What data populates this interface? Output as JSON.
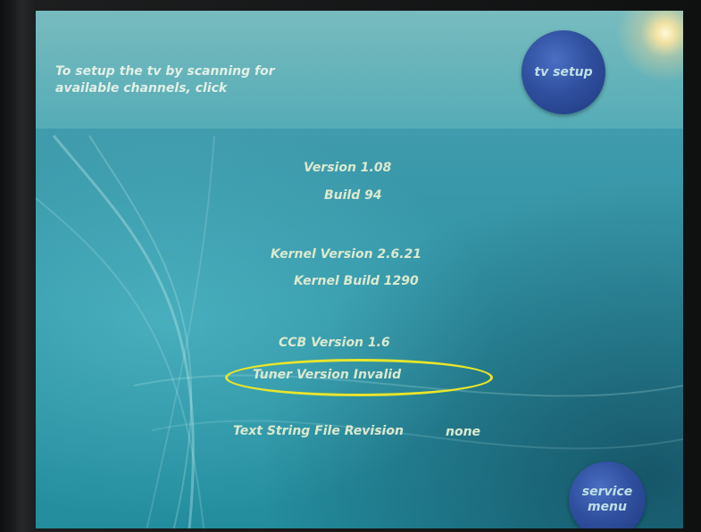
{
  "header": {
    "setup_prompt_line1": "To setup the tv by scanning for",
    "setup_prompt_line2": "available channels, click",
    "tv_setup_button": "tv setup"
  },
  "info": {
    "version": "Version 1.08",
    "build": "Build 94",
    "kernel_version": "Kernel Version 2.6.21",
    "kernel_build": "Kernel Build 1290",
    "ccb_version": "CCB Version 1.6",
    "tuner_version": "Tuner Version Invalid",
    "text_string_label": "Text String File Revision",
    "text_string_value": "none"
  },
  "footer": {
    "service_menu_line1": "service",
    "service_menu_line2": "menu"
  },
  "colors": {
    "screen_teal": "#3b99aa",
    "button_blue": "#30509f",
    "text_light": "#dbe9cf",
    "highlight_yellow": "#e8e52b"
  }
}
